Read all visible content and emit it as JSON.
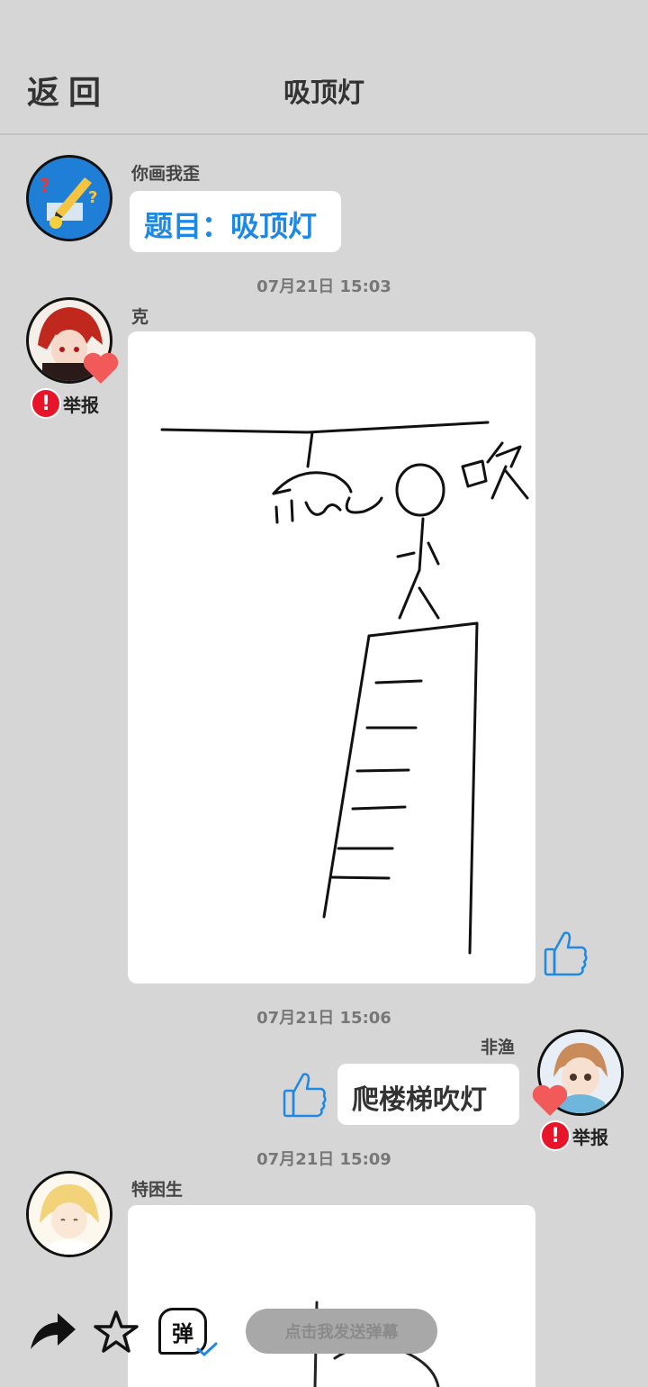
{
  "header": {
    "back_label": "返回",
    "title": "吸顶灯"
  },
  "messages": [
    {
      "sender": "你画我歪",
      "text": "题目：吸顶灯"
    },
    {
      "time": "07月21日  15:03"
    },
    {
      "sender": "克",
      "report": "举报"
    },
    {
      "time": "07月21日  15:06"
    },
    {
      "sender": "非渔",
      "text": "爬楼梯吹灯",
      "report": "举报"
    },
    {
      "time": "07月21日  15:09"
    },
    {
      "sender": "特困生"
    }
  ],
  "drawing": {
    "caption": "吹"
  },
  "bottom": {
    "danmaku_placeholder": "点击我发送弹幕",
    "danmaku_icon_label": "弹"
  },
  "colors": {
    "accent": "#1e88e5",
    "report": "#e8142a",
    "heart": "#f25a5a"
  },
  "icons": [
    "share-arrow-icon",
    "star-icon",
    "danmaku-icon",
    "thumbs-up-icon",
    "heart-icon",
    "report-icon"
  ]
}
